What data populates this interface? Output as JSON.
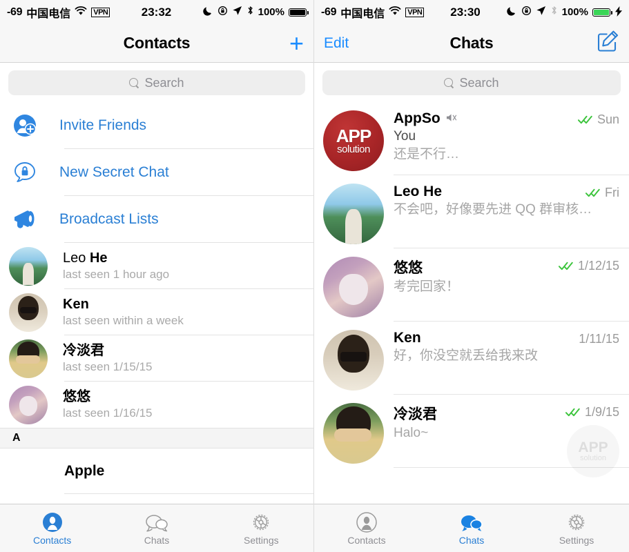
{
  "left": {
    "statusbar": {
      "signal": "-69",
      "carrier": "中国电信",
      "wifi_icon": "wifi-icon",
      "vpn": "VPN",
      "time": "23:32",
      "moon_icon": "moon-icon",
      "lock_rotation_icon": "rotation-lock-icon",
      "location_icon": "location-arrow-icon",
      "bluetooth_icon": "bluetooth-icon",
      "battery_percent": "100%",
      "battery_state": "full",
      "battery_color": "#000000"
    },
    "navbar": {
      "title": "Contacts",
      "right_action": "add-contact",
      "right_icon": "plus-icon"
    },
    "search": {
      "placeholder": "Search",
      "value": ""
    },
    "actions": [
      {
        "label": "Invite Friends",
        "icon": "invite-friend-icon"
      },
      {
        "label": "New Secret Chat",
        "icon": "secret-chat-lock-icon"
      },
      {
        "label": "Broadcast Lists",
        "icon": "megaphone-icon"
      }
    ],
    "contacts": [
      {
        "first": "Leo ",
        "last": "He",
        "status": "last seen 1 hour ago",
        "avatar": "av-leo"
      },
      {
        "first": "Ken",
        "last": "",
        "status": "last seen within a week",
        "avatar": "av-ken"
      },
      {
        "first": "冷淡君",
        "last": "",
        "status": "last seen 1/15/15",
        "avatar": "av-leng"
      },
      {
        "first": "悠悠",
        "last": "",
        "status": "last seen 1/16/15",
        "avatar": "av-cat"
      }
    ],
    "section_header": "A",
    "section_rows": [
      {
        "name": "Apple"
      }
    ],
    "tabs": [
      {
        "label": "Contacts",
        "icon": "contacts-icon",
        "active": true
      },
      {
        "label": "Chats",
        "icon": "chats-icon",
        "active": false
      },
      {
        "label": "Settings",
        "icon": "settings-gear-icon",
        "active": false
      }
    ]
  },
  "right": {
    "statusbar": {
      "signal": "-69",
      "carrier": "中国电信",
      "wifi_icon": "wifi-icon",
      "vpn": "VPN",
      "time": "23:30",
      "moon_icon": "moon-icon",
      "lock_rotation_icon": "rotation-lock-icon",
      "location_icon": "location-arrow-icon",
      "bluetooth_icon": "bluetooth-icon",
      "battery_percent": "100%",
      "battery_state": "charging",
      "battery_color": "#3ad557",
      "charging_bolt": "⚡"
    },
    "navbar": {
      "left_action": "Edit",
      "title": "Chats",
      "right_icon": "compose-icon"
    },
    "search": {
      "placeholder": "Search",
      "value": ""
    },
    "chats": [
      {
        "name": "AppSo",
        "muted": true,
        "sender": "You",
        "message": "还是不行…",
        "date": "Sun",
        "read_receipt": "double-check",
        "avatar": "av-appso"
      },
      {
        "name": "Leo He",
        "muted": false,
        "sender": "",
        "message": "不会吧，好像要先进 QQ 群审核…",
        "date": "Fri",
        "read_receipt": "double-check",
        "avatar": "av-leo"
      },
      {
        "name": "悠悠",
        "muted": false,
        "sender": "",
        "message": "考完回家！",
        "date": "1/12/15",
        "read_receipt": "double-check",
        "avatar": "av-cat"
      },
      {
        "name": "Ken",
        "muted": false,
        "sender": "",
        "message": "好，你没空就丢给我来改",
        "date": "1/11/15",
        "read_receipt": "none",
        "avatar": "av-ken"
      },
      {
        "name": "冷淡君",
        "muted": false,
        "sender": "",
        "message": "Halo~",
        "date": "1/9/15",
        "read_receipt": "double-check",
        "avatar": "av-leng"
      }
    ],
    "watermark": {
      "line1": "APP",
      "line2": "solution"
    },
    "tabs": [
      {
        "label": "Contacts",
        "icon": "contacts-icon",
        "active": false
      },
      {
        "label": "Chats",
        "icon": "chats-icon",
        "active": true
      },
      {
        "label": "Settings",
        "icon": "settings-gear-icon",
        "active": false
      }
    ]
  },
  "colors": {
    "accent": "#2a7fd4",
    "tint": "#1a8cff",
    "check_green": "#3cc43c",
    "muted_text": "#a6a6a6",
    "appso_red": "#a82527"
  }
}
